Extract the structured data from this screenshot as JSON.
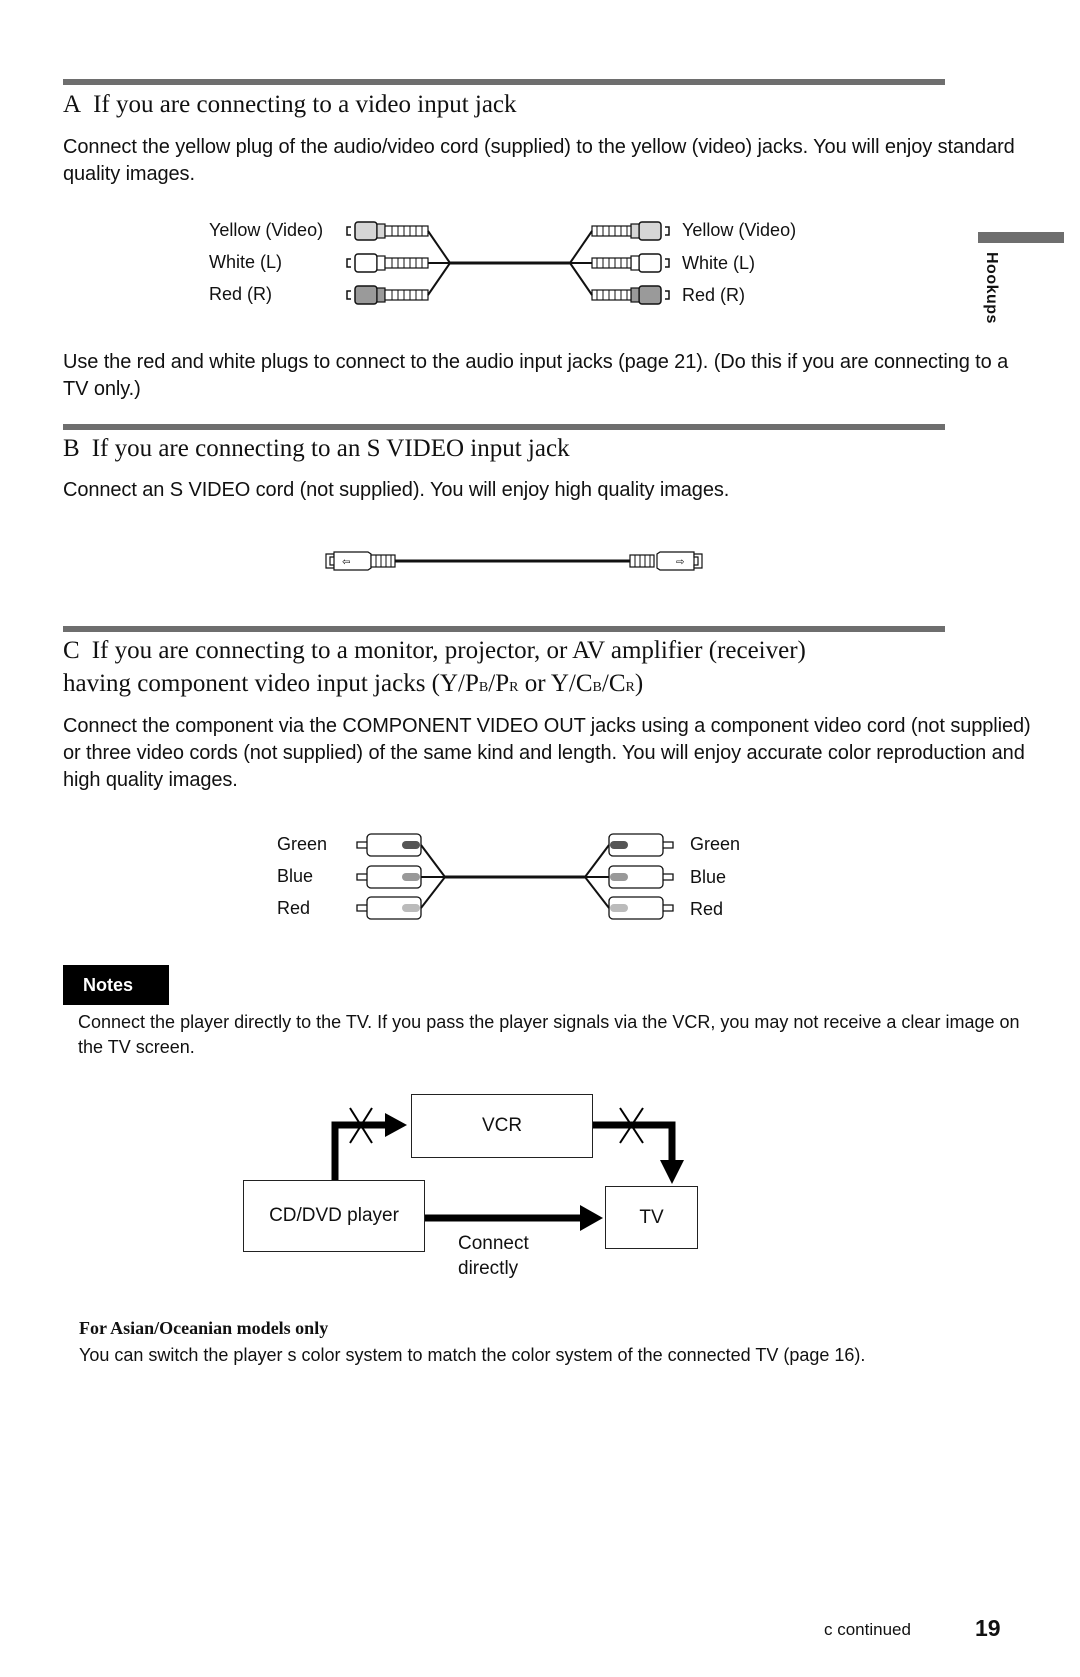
{
  "side_tab": {
    "label": "Hookups"
  },
  "sections": [
    {
      "letter": "A",
      "title": "If you are connecting to a video input jack",
      "paragraph": "Connect the yellow plug of the audio/video cord (supplied) to the yellow (video) jacks. You will enjoy standard quality images.",
      "cable": {
        "left_labels": [
          "Yellow (Video)",
          "White (L)",
          "Red (R)"
        ],
        "right_labels": [
          "Yellow (Video)",
          "White (L)",
          "Red (R)"
        ],
        "plug_colors": [
          "#d6d6d6",
          "#ffffff",
          "#9a9a9a"
        ]
      },
      "paragraph2": "Use the red and white plugs to connect to the audio input jacks (page 21). (Do this if you are connecting to a TV only.)"
    },
    {
      "letter": "B",
      "title": "If you are connecting to an S VIDEO input jack",
      "paragraph": "Connect an S VIDEO cord (not supplied). You will enjoy high quality images."
    },
    {
      "letter": "C",
      "title_line1": "If you are connecting to a monitor, projector, or AV amplifier (receiver)",
      "title_line2_prefix": "having component video input jacks (Y/P",
      "title_sub_b": "B",
      "title_slash1": "/P",
      "title_sub_r": "R",
      "title_or": " or Y/C",
      "title_sub_b2": "B",
      "title_slash2": "/C",
      "title_sub_r2": "R",
      "title_close": ")",
      "paragraph": "Connect the component via the COMPONENT VIDEO OUT jacks using a component video cord (not supplied) or three video cords (not supplied) of the same kind and length. You will enjoy accurate color reproduction and high quality images.",
      "cable": {
        "left_labels": [
          "Green",
          "Blue",
          "Red"
        ],
        "right_labels": [
          "Green",
          "Blue",
          "Red"
        ],
        "tip_colors": [
          "#555555",
          "#999999",
          "#bbbbbb"
        ]
      }
    }
  ],
  "notes": {
    "title": "Notes",
    "text": "Connect the player directly to the TV. If you pass the player signals via the VCR, you may not receive a clear image on the TV screen."
  },
  "diagram": {
    "vcr": "VCR",
    "player": "CD/DVD player",
    "tv": "TV",
    "direct_line1": "Connect",
    "direct_line2": "directly"
  },
  "asian": {
    "heading": "For Asian/Oceanian models only",
    "text": "You can switch the player s color system to match the color system of the connected TV (page 16)."
  },
  "footer": {
    "continued": "c  continued",
    "page_number": "19"
  }
}
